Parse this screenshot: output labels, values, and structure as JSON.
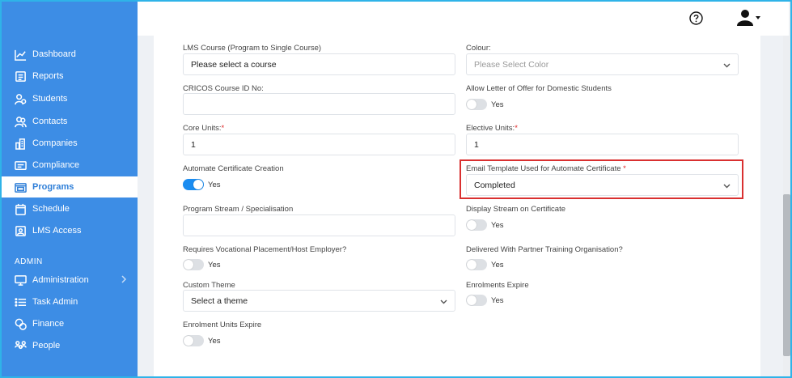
{
  "sidebar": {
    "items": [
      {
        "label": "Dashboard",
        "icon": "chart-line-icon"
      },
      {
        "label": "Reports",
        "icon": "report-icon"
      },
      {
        "label": "Students",
        "icon": "students-icon"
      },
      {
        "label": "Contacts",
        "icon": "contacts-icon"
      },
      {
        "label": "Companies",
        "icon": "companies-icon"
      },
      {
        "label": "Compliance",
        "icon": "compliance-icon"
      },
      {
        "label": "Programs",
        "icon": "programs-icon"
      },
      {
        "label": "Schedule",
        "icon": "schedule-icon"
      },
      {
        "label": "LMS Access",
        "icon": "lms-access-icon"
      }
    ],
    "admin_label": "ADMIN",
    "admin_items": [
      {
        "label": "Administration",
        "icon": "administration-icon"
      },
      {
        "label": "Task Admin",
        "icon": "task-list-icon"
      },
      {
        "label": "Finance",
        "icon": "finance-icon"
      },
      {
        "label": "People",
        "icon": "people-icon"
      }
    ],
    "active": "Programs"
  },
  "header": {
    "help_icon": "help-icon",
    "user_icon": "user-avatar-icon"
  },
  "form": {
    "lms_course": {
      "label": "LMS Course (Program to Single Course)",
      "value": "Please select a course"
    },
    "colour": {
      "label": "Colour:",
      "placeholder": "Please Select Color"
    },
    "cricos": {
      "label": "CRICOS Course ID No:",
      "value": ""
    },
    "allow_letter": {
      "label": "Allow Letter of Offer for Domestic Students",
      "toggle_text": "Yes",
      "on": false
    },
    "core_units": {
      "label": "Core Units:",
      "required_mark": "*",
      "value": "1"
    },
    "elective_units": {
      "label": "Elective Units:",
      "required_mark": "*",
      "value": "1"
    },
    "automate_cert": {
      "label": "Automate Certificate Creation",
      "toggle_text": "Yes",
      "on": true
    },
    "email_template": {
      "label": "Email Template Used for Automate Certificate",
      "required_mark": "*",
      "value": "Completed"
    },
    "program_stream": {
      "label": "Program Stream / Specialisation",
      "value": ""
    },
    "display_stream": {
      "label": "Display Stream on Certificate",
      "toggle_text": "Yes",
      "on": false
    },
    "vocational": {
      "label": "Requires Vocational Placement/Host Employer?",
      "toggle_text": "Yes",
      "on": false
    },
    "partner": {
      "label": "Delivered With Partner Training Organisation?",
      "toggle_text": "Yes",
      "on": false
    },
    "custom_theme": {
      "label": "Custom Theme",
      "value": "Select a theme"
    },
    "enrolments_expire": {
      "label": "Enrolments Expire",
      "toggle_text": "Yes",
      "on": false
    },
    "enrolment_units_expire": {
      "label": "Enrolment Units Expire",
      "toggle_text": "Yes",
      "on": false
    }
  },
  "colors": {
    "sidebar": "#3d8de5",
    "toggle_on": "#1a8cf0",
    "highlight": "#d93030",
    "frame": "#2fb3e8"
  }
}
